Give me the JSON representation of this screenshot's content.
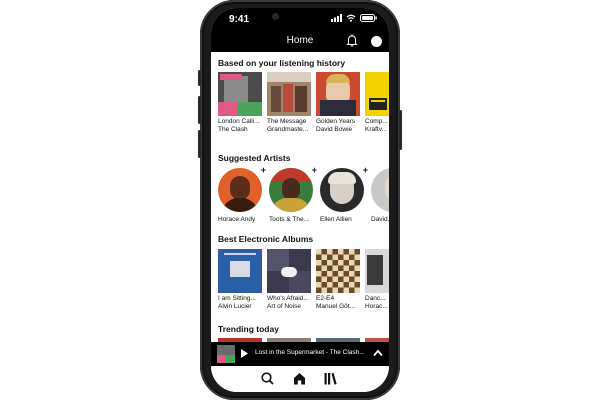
{
  "status": {
    "time": "9:41"
  },
  "app": {
    "title": "Home"
  },
  "sections": {
    "history": {
      "title": "Based on your listening history",
      "items": [
        {
          "line1": "London Calli...",
          "line2": "The Clash"
        },
        {
          "line1": "The Message",
          "line2": "Grandmaste..."
        },
        {
          "line1": "Golden Years",
          "line2": "David Bowie"
        },
        {
          "line1": "Comp...",
          "line2": "Kraftv..."
        }
      ]
    },
    "artists": {
      "title": "Suggested Artists",
      "add_symbol": "+",
      "items": [
        {
          "name": "Horace Andy"
        },
        {
          "name": "Toots & The..."
        },
        {
          "name": "Ellen Allien"
        },
        {
          "name": "David..."
        }
      ]
    },
    "electronic": {
      "title": "Best Electronic Albums",
      "items": [
        {
          "line1": "I am Sitting...",
          "line2": "Alvin Lucier"
        },
        {
          "line1": "Who's Afraid...",
          "line2": "Art of Noise"
        },
        {
          "line1": "E2-E4",
          "line2": "Manuel Göt..."
        },
        {
          "line1": "Danc...",
          "line2": "Horac..."
        }
      ]
    },
    "trending": {
      "title": "Trending today"
    }
  },
  "player": {
    "track": "Lost in the Supermarket - The Clash..."
  },
  "colors": {
    "bar": "#000000",
    "background": "#ffffff"
  },
  "icons": {
    "appbar": [
      "bell-icon",
      "profile-avatar"
    ],
    "tabs": [
      "search-icon",
      "home-icon",
      "library-icon"
    ]
  }
}
